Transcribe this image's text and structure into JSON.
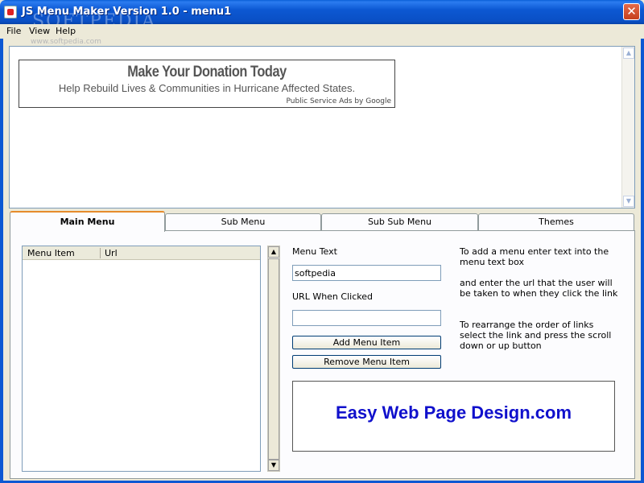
{
  "window": {
    "title": "JS Menu Maker Version 1.0 - menu1",
    "watermark": "SOFTPEDIA",
    "watermark_url": "www.softpedia.com",
    "close_glyph": "✕"
  },
  "menubar": {
    "items": [
      "File",
      "View",
      "Help"
    ]
  },
  "ad": {
    "title": "Make Your Donation Today",
    "subtitle": "Help Rebuild Lives & Communities in Hurricane Affected States.",
    "footer": "Public Service Ads by Google"
  },
  "tabs": [
    "Main Menu",
    "Sub Menu",
    "Sub Sub Menu",
    "Themes"
  ],
  "list": {
    "columns": [
      "Menu Item",
      "Url"
    ]
  },
  "form": {
    "menu_text_label": "Menu Text",
    "menu_text_value": "softpedia",
    "url_label": "URL When Clicked",
    "url_value": "",
    "add_button": "Add Menu Item",
    "remove_button": "Remove Menu Item"
  },
  "help": {
    "p1": "To add a menu enter text into the menu text box",
    "p2": "and enter the url that the user will be taken to when they click the link",
    "p3": "To rearrange the order of links select the link and press the scroll down or up button"
  },
  "banner": {
    "text": "Easy Web Page Design.com"
  },
  "colors": {
    "titlebar": "#0c58d3",
    "active_tab_accent": "#e68b2c",
    "banner_text": "#1010cc"
  }
}
